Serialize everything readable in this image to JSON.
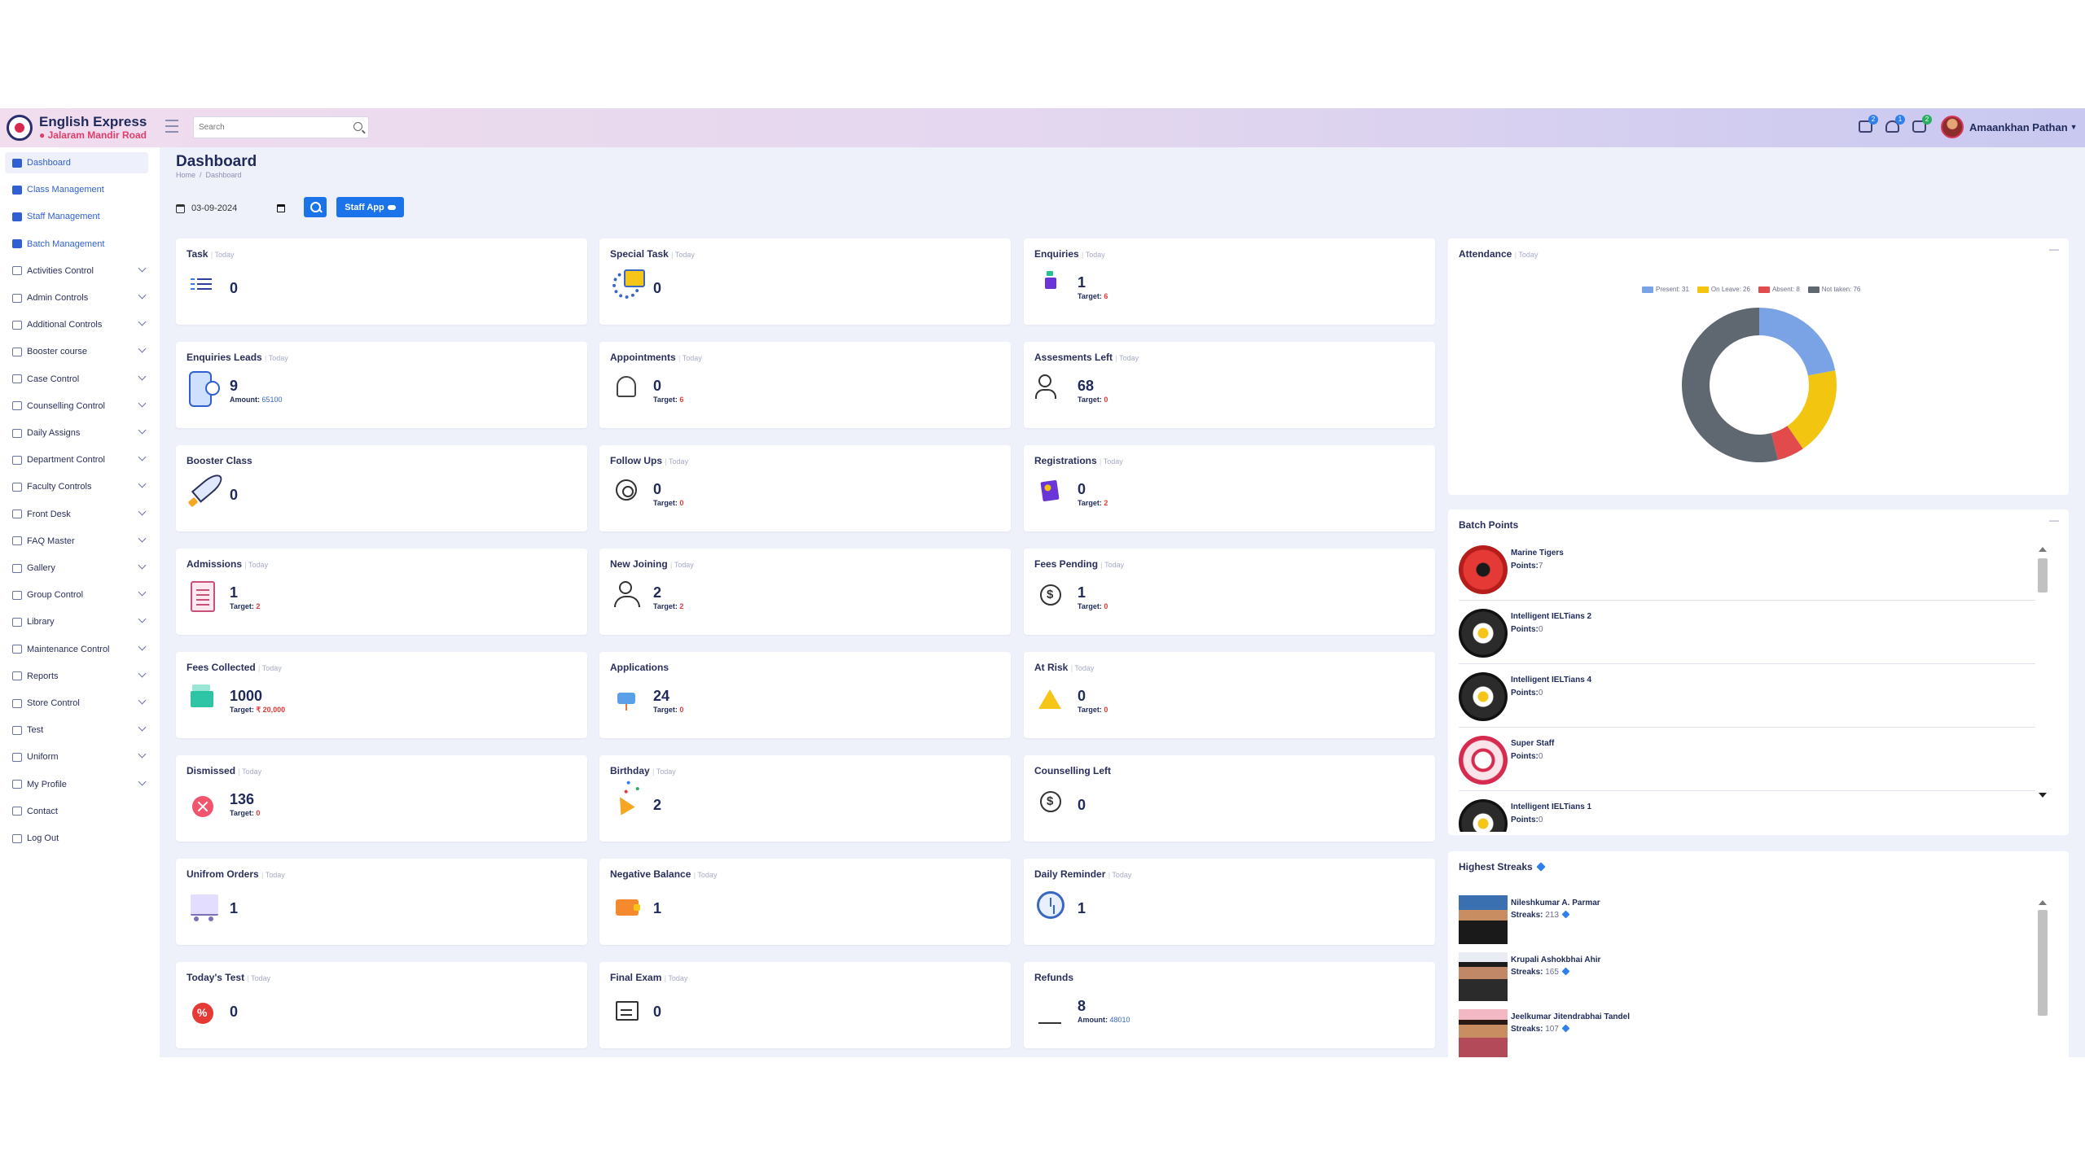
{
  "brand": {
    "name": "English Express",
    "location": "Jalaram Mandir Road"
  },
  "search": {
    "placeholder": "Search"
  },
  "topbar": {
    "badges": {
      "notes": "2",
      "bell": "1",
      "chat": "2"
    },
    "user_name": "Amaankhan Pathan"
  },
  "sidebar": {
    "items": [
      {
        "label": "Dashboard",
        "icon": "grid-icon",
        "active": true
      },
      {
        "label": "Class Management",
        "icon": "class-icon"
      },
      {
        "label": "Staff Management",
        "icon": "staff-icon"
      },
      {
        "label": "Batch Management",
        "icon": "grid-icon"
      },
      {
        "label": "Activities Control",
        "icon": "activity-icon"
      },
      {
        "label": "Admin Controls",
        "icon": "admin-icon"
      },
      {
        "label": "Additional Controls",
        "icon": "additional-icon"
      },
      {
        "label": "Booster course",
        "icon": "booster-icon"
      },
      {
        "label": "Case Control",
        "icon": "case-icon"
      },
      {
        "label": "Counselling Control",
        "icon": "counselling-icon"
      },
      {
        "label": "Daily Assigns",
        "icon": "daily-icon"
      },
      {
        "label": "Department Control",
        "icon": "department-icon"
      },
      {
        "label": "Faculty Controls",
        "icon": "faculty-icon"
      },
      {
        "label": "Front Desk",
        "icon": "desk-icon"
      },
      {
        "label": "FAQ Master",
        "icon": "faq-icon"
      },
      {
        "label": "Gallery",
        "icon": "gallery-icon"
      },
      {
        "label": "Group Control",
        "icon": "group-icon"
      },
      {
        "label": "Library",
        "icon": "library-icon"
      },
      {
        "label": "Maintenance Control",
        "icon": "maintenance-icon"
      },
      {
        "label": "Reports",
        "icon": "reports-icon"
      },
      {
        "label": "Store Control",
        "icon": "store-icon"
      },
      {
        "label": "Test",
        "icon": "test-icon"
      },
      {
        "label": "Uniform",
        "icon": "uniform-icon"
      },
      {
        "label": "My Profile",
        "icon": "profile-icon"
      },
      {
        "label": "Contact",
        "icon": "contact-icon"
      },
      {
        "label": "Log Out",
        "icon": "logout-icon"
      }
    ]
  },
  "page": {
    "title": "Dashboard",
    "breadcrumb": [
      "Home",
      "Dashboard"
    ],
    "date": "03-09-2024",
    "staff_app_label": "Staff App"
  },
  "cards": {
    "task": {
      "title": "Task",
      "sub": "Today",
      "value": "0"
    },
    "special_task": {
      "title": "Special Task",
      "sub": "Today",
      "value": "0"
    },
    "enquiries": {
      "title": "Enquiries",
      "sub": "Today",
      "value": "1",
      "target_label": "Target:",
      "target": "6"
    },
    "enquiries_leads": {
      "title": "Enquiries Leads",
      "sub": "Today",
      "value": "9",
      "target_label": "Amount:",
      "target": "65100"
    },
    "appointments": {
      "title": "Appointments",
      "sub": "Today",
      "value": "0",
      "target_label": "Target:",
      "target": "6"
    },
    "assessments_left": {
      "title": "Assesments Left",
      "sub": "Today",
      "value": "68",
      "target_label": "Target:",
      "target": "0"
    },
    "booster_class": {
      "title": "Booster Class",
      "value": "0"
    },
    "follow_ups": {
      "title": "Follow Ups",
      "sub": "Today",
      "value": "0",
      "target_label": "Target:",
      "target": "0"
    },
    "registrations": {
      "title": "Registrations",
      "sub": "Today",
      "value": "0",
      "target_label": "Target:",
      "target": "2"
    },
    "admissions": {
      "title": "Admissions",
      "sub": "Today",
      "value": "1",
      "target_label": "Target:",
      "target": "2"
    },
    "new_joining": {
      "title": "New Joining",
      "sub": "Today",
      "value": "2",
      "target_label": "Target:",
      "target": "2"
    },
    "fees_pending": {
      "title": "Fees Pending",
      "sub": "Today",
      "value": "1",
      "target_label": "Target:",
      "target": "0"
    },
    "fees_collected": {
      "title": "Fees Collected",
      "sub": "Today",
      "value": "1000",
      "target_label": "Target:",
      "target": "₹ 20,000"
    },
    "applications": {
      "title": "Applications",
      "value": "24",
      "target_label": "Target:",
      "target": "0"
    },
    "at_risk": {
      "title": "At Risk",
      "sub": "Today",
      "value": "0",
      "target_label": "Target:",
      "target": "0"
    },
    "dismissed": {
      "title": "Dismissed",
      "sub": "Today",
      "value": "136",
      "target_label": "Target:",
      "target": "0"
    },
    "birthday": {
      "title": "Birthday",
      "sub": "Today",
      "value": "2"
    },
    "counselling_left": {
      "title": "Counselling Left",
      "value": "0"
    },
    "uniform_orders": {
      "title": "Unifrom Orders",
      "sub": "Today",
      "value": "1"
    },
    "negative_balance": {
      "title": "Negative Balance",
      "sub": "Today",
      "value": "1"
    },
    "daily_reminder": {
      "title": "Daily Reminder",
      "sub": "Today",
      "value": "1"
    },
    "todays_test": {
      "title": "Today's Test",
      "sub": "Today",
      "value": "0"
    },
    "final_exam": {
      "title": "Final Exam",
      "sub": "Today",
      "value": "0"
    },
    "refunds": {
      "title": "Refunds",
      "value": "8",
      "target_label": "Amount:",
      "target": "48010"
    }
  },
  "attendance": {
    "title": "Attendance",
    "sub": "Today",
    "legend": [
      {
        "label": "Present: 31",
        "color": "#7aa3e5"
      },
      {
        "label": "On Leave: 26",
        "color": "#f2c511"
      },
      {
        "label": "Absent: 8",
        "color": "#e24b4b"
      },
      {
        "label": "Not taken: 76",
        "color": "#5f6770"
      }
    ]
  },
  "chart_data": {
    "type": "pie",
    "title": "",
    "series": [
      {
        "name": "Present",
        "value": 31,
        "color": "#7aa3e5"
      },
      {
        "name": "On Leave",
        "value": 26,
        "color": "#f2c511"
      },
      {
        "name": "Absent",
        "value": 8,
        "color": "#e24b4b"
      },
      {
        "name": "Not taken",
        "value": 76,
        "color": "#5f6770"
      }
    ],
    "legend": "top"
  },
  "batch_points": {
    "title": "Batch Points",
    "points_label": "Points:",
    "items": [
      {
        "name": "Marine Tigers",
        "points": "7"
      },
      {
        "name": "Intelligent IELTians 2",
        "points": "0"
      },
      {
        "name": "Intelligent IELTians 4",
        "points": "0"
      },
      {
        "name": "Super Staff",
        "points": "0"
      },
      {
        "name": "Intelligent IELTians 1",
        "points": "0"
      }
    ]
  },
  "highest_streaks": {
    "title": "Highest Streaks",
    "streaks_label": "Streaks:",
    "items": [
      {
        "name": "Nileshkumar A. Parmar",
        "streaks": "213"
      },
      {
        "name": "Krupali Ashokbhai Ahir",
        "streaks": "165"
      },
      {
        "name": "Jeelkumar Jitendrabhai Tandel",
        "streaks": "107"
      }
    ]
  }
}
